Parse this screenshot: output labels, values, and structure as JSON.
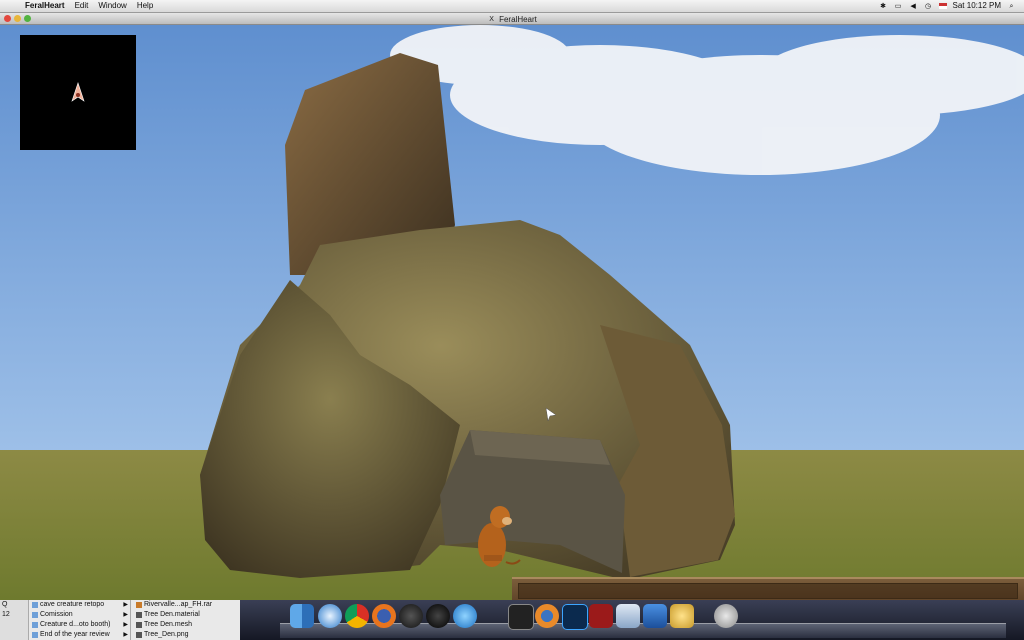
{
  "menubar": {
    "app_name": "FeralHeart",
    "items": [
      "Edit",
      "Window",
      "Help"
    ],
    "clock": "Sat 10:12 PM"
  },
  "window": {
    "title": "FeralHeart"
  },
  "finder": {
    "col0": [
      "Q",
      "12"
    ],
    "col1": [
      "cave creature retopo",
      "Comission",
      "Creature d...oto booth)",
      "End of the year review"
    ],
    "col2": [
      "Rivervalle...ap_FH.rar",
      "Tree Den.material",
      "Tree Den.mesh",
      "Tree_Den.png"
    ]
  },
  "dock": {
    "icons": [
      "finder-icon",
      "safari-icon",
      "chrome-icon",
      "firefox-icon",
      "steam-icon",
      "dashboard-icon",
      "itunes-icon",
      "terminal-icon",
      "blender-icon",
      "photoshop-icon",
      "app-icon",
      "preview-icon",
      "xcode-icon",
      "game-icon",
      "trash-icon"
    ]
  },
  "colors": {
    "sky": "#6f9bd4",
    "grass": "#8a8e3c",
    "rock": "#5e5431"
  }
}
